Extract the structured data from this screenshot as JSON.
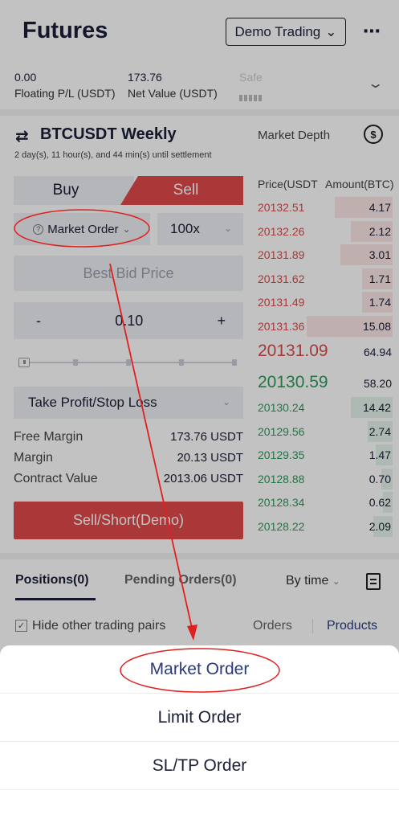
{
  "header": {
    "title": "Futures",
    "mode_label": "Demo Trading",
    "mode_chevron_icon": "chevron-down-icon",
    "more_icon": "more-dots-icon"
  },
  "summary": {
    "floating_pl_value": "0.00",
    "floating_pl_label": "Floating P/L (USDT)",
    "net_value": "173.76",
    "net_value_label": "Net Value (USDT)",
    "safety_label": "Safe"
  },
  "pair": {
    "name": "BTCUSDT Weekly",
    "settlement": "2 day(s), 11 hour(s), and 44 min(s) until settlement",
    "swap_icon": "swap-arrows-icon"
  },
  "trade": {
    "buy_label": "Buy",
    "sell_label": "Sell",
    "order_type": "Market Order",
    "leverage": "100x",
    "price_placeholder": "Best Bid Price",
    "qty_minus": "-",
    "qty_value": "0.10",
    "qty_plus": "+",
    "slider_handle": "III",
    "tpsl_label": "Take Profit/Stop Loss",
    "free_margin_label": "Free Margin",
    "free_margin_value": "173.76 USDT",
    "margin_label": "Margin",
    "margin_value": "20.13 USDT",
    "contract_value_label": "Contract Value",
    "contract_value_value": "2013.06 USDT",
    "submit_label": "Sell/Short(Demo)"
  },
  "order_book": {
    "title": "Market Depth",
    "depth_icon": "dollar-circle-icon",
    "price_header": "Price(USDT",
    "amount_header": "Amount(BTC)",
    "asks": [
      {
        "price": "20132.51",
        "amount": "4.17",
        "depth": 0.42
      },
      {
        "price": "20132.26",
        "amount": "2.12",
        "depth": 0.3
      },
      {
        "price": "20131.89",
        "amount": "3.01",
        "depth": 0.38
      },
      {
        "price": "20131.62",
        "amount": "1.71",
        "depth": 0.22
      },
      {
        "price": "20131.49",
        "amount": "1.74",
        "depth": 0.22
      },
      {
        "price": "20131.36",
        "amount": "15.08",
        "depth": 0.62
      }
    ],
    "ask_last_price": "20131.09",
    "ask_last_amount": "64.94",
    "bid_last_price": "20130.59",
    "bid_last_amount": "58.20",
    "bids": [
      {
        "price": "20130.24",
        "amount": "14.42",
        "depth": 0.3
      },
      {
        "price": "20129.56",
        "amount": "2.74",
        "depth": 0.18
      },
      {
        "price": "20129.35",
        "amount": "1.47",
        "depth": 0.12
      },
      {
        "price": "20128.88",
        "amount": "0.70",
        "depth": 0.08
      },
      {
        "price": "20128.34",
        "amount": "0.62",
        "depth": 0.07
      },
      {
        "price": "20128.22",
        "amount": "2.09",
        "depth": 0.14
      }
    ],
    "ask_color": "#d94a4a",
    "bid_color": "#2e9a5a"
  },
  "positions": {
    "positions_tab": "Positions(0)",
    "pending_tab": "Pending Orders(0)",
    "sort_label": "By time",
    "hide_pairs_label": "Hide other trading pairs",
    "orders_link": "Orders",
    "products_link": "Products"
  },
  "sheet": {
    "items": [
      "Market Order",
      "Limit Order",
      "SL/TP Order"
    ]
  },
  "colors": {
    "accent_red": "#e04a4a",
    "annotation_red": "#e02020"
  }
}
